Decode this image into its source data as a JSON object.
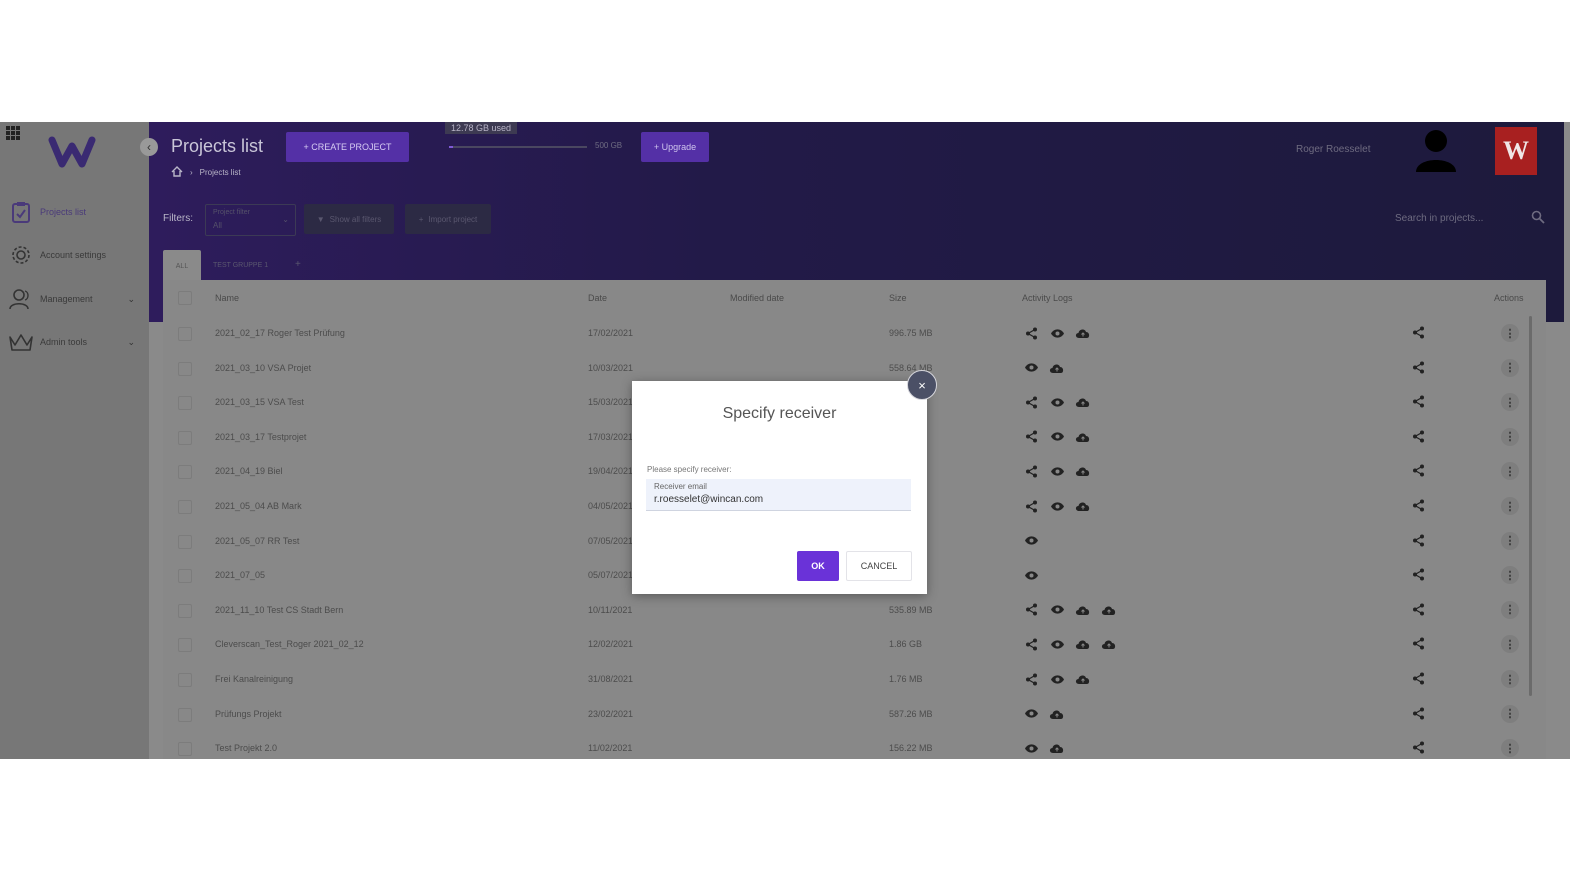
{
  "header": {
    "title": "Projects list",
    "create_button": "+ CREATE PROJECT",
    "breadcrumb": [
      "Projects list"
    ],
    "storage_used": "12.78 GB used",
    "storage_total": "500 GB",
    "storage_fraction": 0.026,
    "upgrade_button": "+ Upgrade",
    "user_name": "Roger Roesselet",
    "brand_logo_text": "W"
  },
  "sidebar": {
    "items": [
      {
        "label": "Projects list",
        "icon": "clipboard-icon"
      },
      {
        "label": "Account settings",
        "icon": "gear-icon"
      },
      {
        "label": "Management",
        "icon": "users-icon"
      },
      {
        "label": "Admin tools",
        "icon": "crown-icon"
      }
    ]
  },
  "filters": {
    "label": "Filters:",
    "project_filter_label": "Project filter",
    "project_filter_value": "All",
    "show_all_filters": "Show all filters",
    "import_project": "Import project",
    "search_placeholder": "Search in projects..."
  },
  "tabs": [
    {
      "label": "ALL"
    },
    {
      "label": "TEST GRUPPE 1"
    },
    {
      "label": "+"
    }
  ],
  "table": {
    "columns": [
      "Name",
      "Date",
      "Modified date",
      "Size",
      "Activity Logs",
      "Actions"
    ],
    "rows": [
      {
        "name": "2021_02_17 Roger Test Prüfung",
        "date": "17/02/2021",
        "size": "996.75 MB",
        "icons": [
          "share",
          "eye",
          "cloud"
        ]
      },
      {
        "name": "2021_03_10 VSA Projet",
        "date": "10/03/2021",
        "size": "558.64 MB",
        "icons": [
          "eye",
          "cloud"
        ]
      },
      {
        "name": "2021_03_15 VSA Test",
        "date": "15/03/2021",
        "size": "",
        "icons": [
          "share",
          "eye",
          "cloud"
        ]
      },
      {
        "name": "2021_03_17 Testprojet",
        "date": "17/03/2021",
        "size": "",
        "icons": [
          "share",
          "eye",
          "cloud"
        ]
      },
      {
        "name": "2021_04_19 Biel",
        "date": "19/04/2021",
        "size": "",
        "icons": [
          "share",
          "eye",
          "cloud"
        ]
      },
      {
        "name": "2021_05_04 AB Mark",
        "date": "04/05/2021",
        "size": "",
        "icons": [
          "share",
          "eye",
          "cloud"
        ]
      },
      {
        "name": "2021_05_07 RR Test",
        "date": "07/05/2021",
        "size": "",
        "icons": [
          "eye"
        ]
      },
      {
        "name": "2021_07_05",
        "date": "05/07/2021",
        "size": "",
        "icons": [
          "eye"
        ]
      },
      {
        "name": "2021_11_10 Test CS Stadt Bern",
        "date": "10/11/2021",
        "size": "535.89 MB",
        "icons": [
          "share",
          "eye",
          "cloud",
          "cloud"
        ]
      },
      {
        "name": "Cleverscan_Test_Roger 2021_02_12",
        "date": "12/02/2021",
        "size": "1.86 GB",
        "icons": [
          "share",
          "eye",
          "cloud",
          "cloud"
        ]
      },
      {
        "name": "Frei Kanalreinigung",
        "date": "31/08/2021",
        "size": "1.76 MB",
        "icons": [
          "share",
          "eye",
          "cloud"
        ]
      },
      {
        "name": "Prüfungs Projekt",
        "date": "23/02/2021",
        "size": "587.26 MB",
        "icons": [
          "eye",
          "cloud"
        ]
      },
      {
        "name": "Test Projekt 2.0",
        "date": "11/02/2021",
        "size": "156.22 MB",
        "icons": [
          "eye",
          "cloud"
        ]
      }
    ]
  },
  "modal": {
    "title": "Specify receiver",
    "prompt": "Please specify receiver:",
    "field_label": "Receiver email",
    "field_value": "r.roesselet@wincan.com",
    "ok": "OK",
    "cancel": "CANCEL",
    "close": "×"
  },
  "colors": {
    "accent": "#6a32d8",
    "header_bg": "#221a48",
    "overlay": "#8a8a8a"
  }
}
